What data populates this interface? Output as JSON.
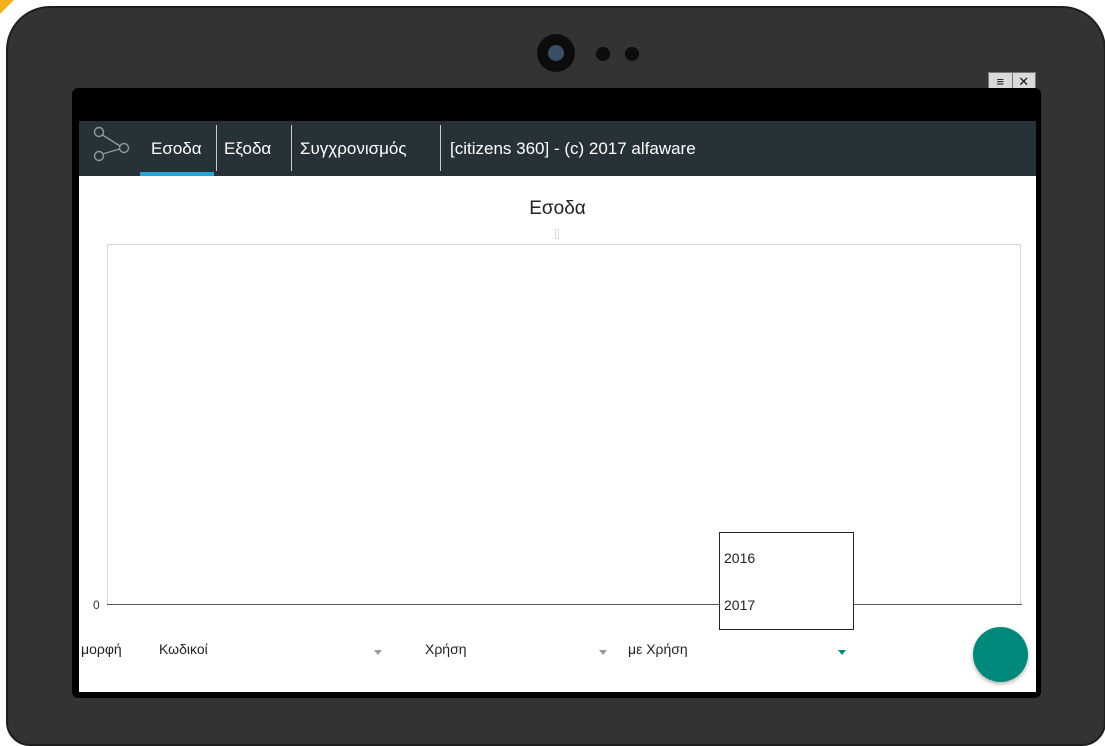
{
  "window_controls": {
    "menu": "≡",
    "close": "✕"
  },
  "nav": {
    "tabs": [
      {
        "label": "Εσοδα",
        "active": true
      },
      {
        "label": "Εξοδα",
        "active": false
      },
      {
        "label": "Συγχρονισμός",
        "active": false
      }
    ],
    "app_title": "[citizens 360] - (c) 2017 alfaware",
    "app_icon": "share-icon"
  },
  "chart_data": {
    "type": "bar",
    "title": "Εσοδα",
    "categories": [],
    "series": [],
    "y_ticks": [
      "0"
    ],
    "ylim": [
      0,
      0
    ],
    "grid": false,
    "legend_position": "top-center"
  },
  "dropdown": {
    "options": [
      "2016",
      "2017"
    ]
  },
  "controls": {
    "format_label": "μορφή",
    "format_select": "Κωδικοί",
    "year_select": "Χρήση",
    "compare_select": "με Χρήση"
  },
  "colors": {
    "appbar": "#263238",
    "tab_indicator": "#26a5d6",
    "accent": "#00897b",
    "device_frame": "#333333"
  }
}
